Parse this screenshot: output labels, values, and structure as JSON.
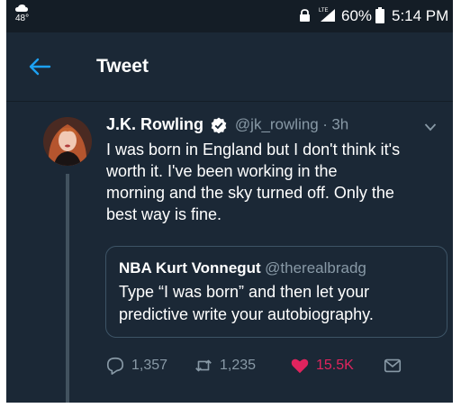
{
  "status_bar": {
    "temperature": "48°",
    "network": "LTE",
    "battery": "60%",
    "time": "5:14 PM"
  },
  "header": {
    "title": "Tweet"
  },
  "tweet": {
    "author_name": "J.K. Rowling",
    "handle": "@jk_rowling",
    "separator": "·",
    "time": "3h",
    "text_lines": [
      "I was born in England but I don't think it's",
      "worth it. I've been working in the",
      "morning and the sky turned off. Only the",
      "best way is fine."
    ],
    "quoted": {
      "author_name": "NBA Kurt Vonnegut",
      "handle": "@therealbradg",
      "text_lines": [
        "Type “I was born” and then let your",
        "predictive write your autobiography."
      ]
    },
    "stats": {
      "replies": "1,357",
      "retweets": "1,235",
      "likes": "15.5K"
    }
  },
  "colors": {
    "background": "#1b2836",
    "accent": "#1da1f2",
    "like": "#e0245e",
    "muted": "#8899a6"
  }
}
